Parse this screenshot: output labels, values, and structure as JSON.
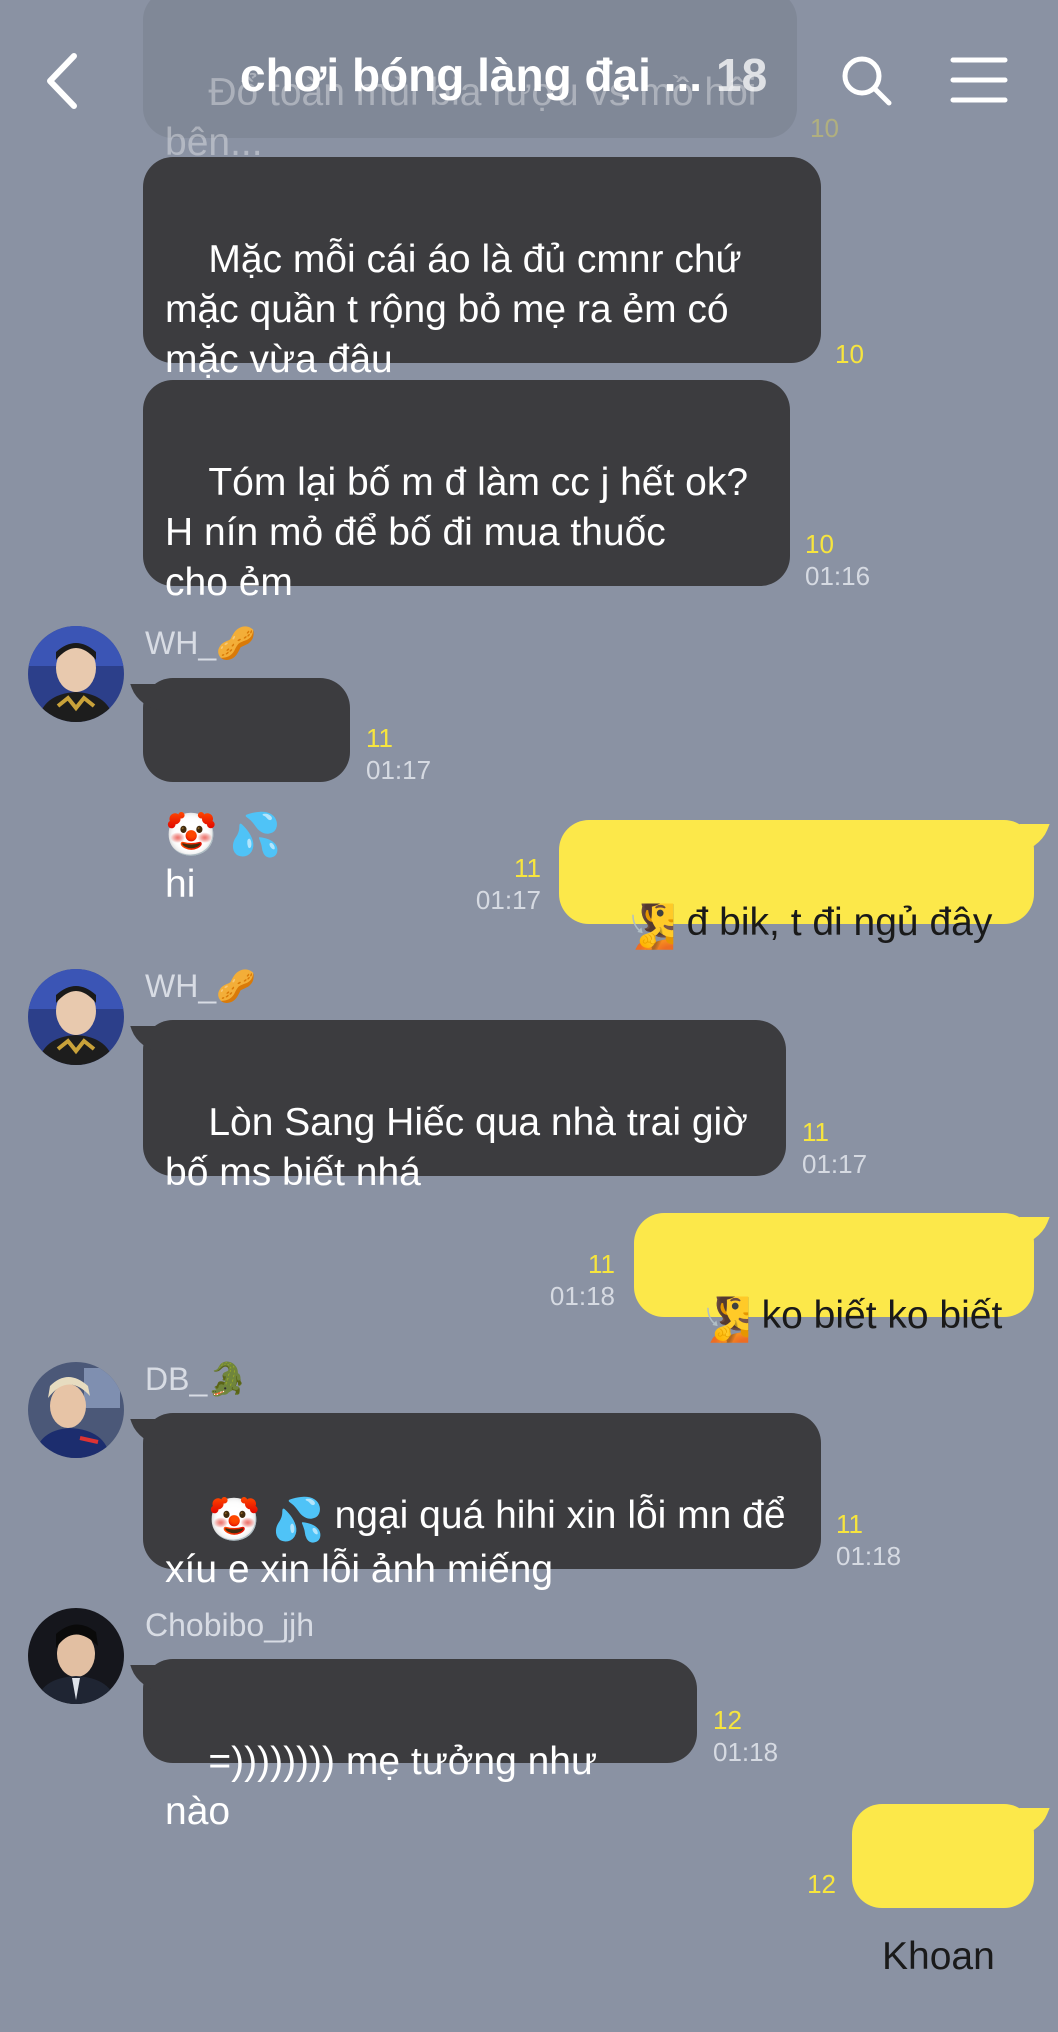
{
  "header": {
    "title": "chơi bóng làng đại ...",
    "member_count": "18"
  },
  "icons": {
    "back": "chevron-left-icon",
    "search": "search-icon",
    "menu": "hamburger-menu-icon"
  },
  "colors": {
    "background": "#8a92a3",
    "incoming_bubble": "#3c3c3f",
    "outgoing_bubble": "#fce84a",
    "unread_count": "#f7e53e"
  },
  "messages": [
    {
      "id": "m0",
      "direction": "in",
      "text": "Đổ toàn mùi bia rượu vs mồ hôi\nbện...",
      "unread": "10",
      "time": "",
      "faded": true
    },
    {
      "id": "m1",
      "direction": "in",
      "text": "Mặc mỗi cái áo là đủ cmnr chứ\nmặc quần t rộng bỏ mẹ ra ẻm có\nmặc vừa đâu",
      "unread": "10",
      "time": ""
    },
    {
      "id": "m2",
      "direction": "in",
      "text": "Tóm lại bố m đ làm cc j hết ok?\nH nín mỏ để bố đi mua thuốc\ncho ẻm",
      "unread": "10",
      "time": "01:16"
    },
    {
      "id": "m3",
      "direction": "in",
      "sender": "WH_🥜",
      "emoji": "🤡 💦",
      "text": "hi",
      "unread": "11",
      "time": "01:17"
    },
    {
      "id": "m4",
      "direction": "out",
      "emoji": "🧏",
      "text": "đ bik, t đi ngủ đây",
      "unread": "11",
      "time": "01:17"
    },
    {
      "id": "m5",
      "direction": "in",
      "sender": "WH_🥜",
      "text": "Lòn Sang Hiếc qua nhà trai giờ\nbố ms biết nhá",
      "unread": "11",
      "time": "01:17"
    },
    {
      "id": "m6",
      "direction": "out",
      "emoji": "🧏",
      "text": "ko biết ko biết",
      "unread": "11",
      "time": "01:18"
    },
    {
      "id": "m7",
      "direction": "in",
      "sender": "DB_🐊",
      "emoji": "🤡 💦",
      "text": "ngại quá hihi xin lỗi mn để\nxíu e xin lỗi ảnh miếng",
      "unread": "11",
      "time": "01:18"
    },
    {
      "id": "m8",
      "direction": "in",
      "sender": "Chobibo_jjh",
      "text": "=)))))))) mẹ tưởng như nào",
      "unread": "12",
      "time": "01:18"
    },
    {
      "id": "m9",
      "direction": "out",
      "text": "Khoan",
      "unread": "12",
      "time": ""
    }
  ]
}
